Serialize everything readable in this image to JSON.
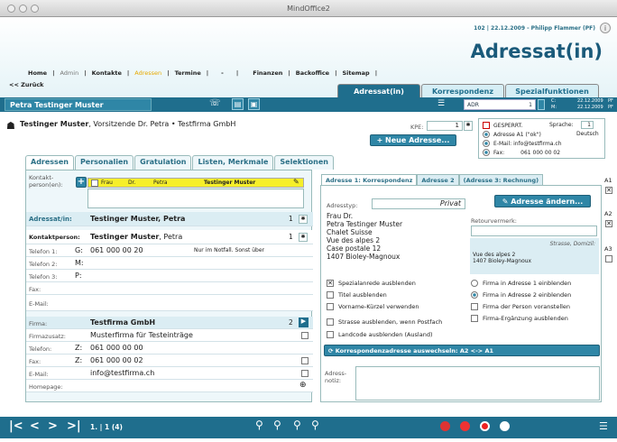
{
  "window": {
    "title": "MindOffice2"
  },
  "header": {
    "user_line": "102 | 22.12.2009 - Philipp Flammer (PF)",
    "big_title": "Adressat(in)",
    "back": "<< Zurück"
  },
  "nav": [
    "Home",
    "Admin",
    "Kontakte",
    "Adressen",
    "Termine",
    "-",
    "Finanzen",
    "Backoffice",
    "Sitemap"
  ],
  "top_tabs": [
    "Adressat(in)",
    "Korrespondenz",
    "Spezialfunktionen"
  ],
  "record_bar": {
    "name": "Petra Testinger Muster",
    "adr_label": "ADR",
    "adr_value": "1",
    "c_label": "C:",
    "c_value": "22.12.2009",
    "m_label": "M:",
    "m_value": "22.12.2009",
    "pf1": "PF",
    "pf2": "PF"
  },
  "person": {
    "name": "Testinger Muster",
    "rest": ", Vorsitzende Dr. Petra • Testfirma GmbH",
    "kpe_label": "KPE:",
    "kpe_value": "1",
    "neue_adresse": "+ Neue Adresse...",
    "gesperrt": "GESPERRT.",
    "sprache_label": "Sprache:",
    "sprache_value": "Deutsch",
    "sprache_num": "1",
    "adresse_a1": "Adresse A1 (\"ok\")",
    "email_line": "E-Mail: info@testfirma.ch",
    "fax_line": "Fax:",
    "fax_value": "061 000 00 02"
  },
  "sub_tabs": [
    "Adressen",
    "Personalien",
    "Gratulation",
    "Listen, Merkmale",
    "Selektionen"
  ],
  "left": {
    "kontakt_label": "Kontakt-person(en):",
    "kontakt_row": [
      "Frau",
      "Dr.",
      "Petra",
      "Testinger Muster"
    ],
    "adressat_label": "Adressat/in:",
    "adressat_value": "Testinger Muster, Petra",
    "adressat_num": "1",
    "kp_label": "Kontaktperson:",
    "kp_bold": "Testinger Muster",
    "kp_rest": ", Petra",
    "kp_num": "1",
    "tel1_label": "Telefon 1:",
    "tel1_type": "G:",
    "tel1_value": "061 000 00 20",
    "tel1_note": "Nur im Notfall. Sonst über",
    "tel2_label": "Telefon 2:",
    "tel2_type": "M:",
    "tel3_label": "Telefon 3:",
    "tel3_type": "P:",
    "fax_label": "Fax:",
    "email_label": "E-Mail:",
    "firma_label": "Firma:",
    "firma_value": "Testfirma GmbH",
    "firma_num": "2",
    "zusatz_label": "Firmazusatz:",
    "zusatz_value": "Musterfirma für Testeinträge",
    "ftel_label": "Telefon:",
    "ftel_type": "Z:",
    "ftel_value": "061 000 00 00",
    "ffax_label": "Fax:",
    "ffax_type": "Z:",
    "ffax_value": "061 000 00 02",
    "femail_label": "E-Mail:",
    "femail_value": "info@testfirma.ch",
    "home_label": "Homepage:"
  },
  "right": {
    "tabs": [
      "Adresse 1: Korrespondenz",
      "Adresse 2",
      "(Adresse 3: Rechnung)"
    ],
    "typ_label": "Adresstyp:",
    "typ_value": "Privat",
    "aendern": "Adresse ändern...",
    "address_lines": [
      "Frau Dr.",
      "Petra Testinger Muster",
      "Chalet Suisse",
      "Vue des alpes 2",
      "Case postale 12",
      "1407 Bioley-Magnoux"
    ],
    "retour_label": "Retourvermerk:",
    "strasse_label": "Strasse, Domizil:",
    "strasse_value": "Vue des alpes 2",
    "ort_value": "1407 Bioley-Magnoux",
    "options_left": [
      "Spezialanrede ausblenden",
      "Titel ausblenden",
      "Vorname-Kürzel verwenden",
      "Strasse ausblenden, wenn Postfach",
      "Landcode ausblenden (Ausland)"
    ],
    "options_right": [
      "Firma in Adresse 1 einblenden",
      "Firma in Adresse 2 einblenden",
      "Firma der Person voranstellen",
      "Firma-Ergänzung ausblenden"
    ],
    "switch": "Korrespondenzadresse auswechseln: A2 <-> A1",
    "notiz_label": "Adress-notiz:"
  },
  "side_labels": [
    "A1",
    "A2",
    "A3"
  ],
  "bottom": {
    "record": "1. | 1 (4)"
  }
}
